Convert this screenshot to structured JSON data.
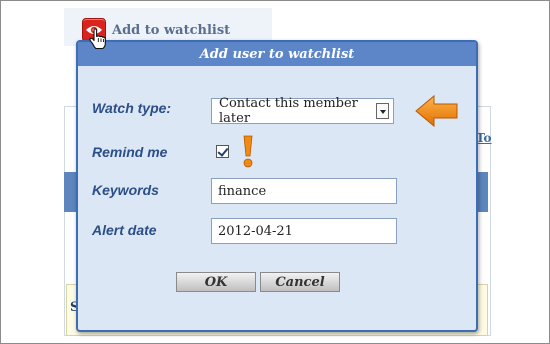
{
  "trigger": {
    "label": "Add to watchlist"
  },
  "background": {
    "right_link": "To",
    "section_letter": "S"
  },
  "dialog": {
    "title": "Add user to watchlist",
    "fields": {
      "watch_type": {
        "label": "Watch type:",
        "value": "Contact this member later"
      },
      "remind_me": {
        "label": "Remind me",
        "checked": true
      },
      "keywords": {
        "label": "Keywords",
        "value": "finance"
      },
      "alert_date": {
        "label": "Alert date",
        "value": "2012-04-21"
      }
    },
    "buttons": {
      "ok": "OK",
      "cancel": "Cancel"
    }
  },
  "colors": {
    "accent": "#5d86c8",
    "label": "#2b4f86",
    "annotation": "#f08a12",
    "eye_button": "#d9231c"
  },
  "icons": {
    "trigger_icon": "eye-icon",
    "cursor": "hand-pointer-icon",
    "dropdown": "chevron-down-icon",
    "annotation_arrow": "arrow-left-icon",
    "annotation_exclaim": "exclamation-icon"
  }
}
